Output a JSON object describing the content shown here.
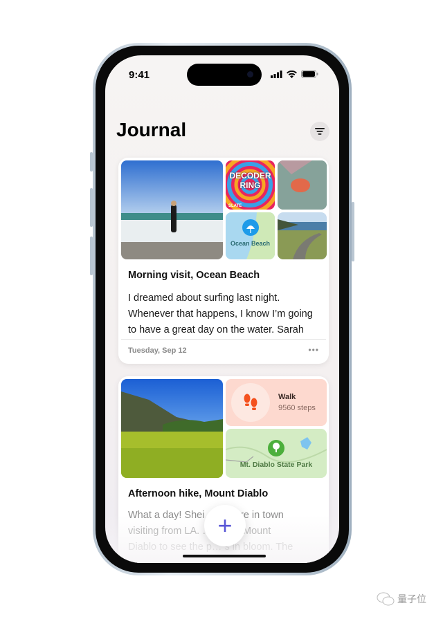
{
  "status_bar": {
    "time": "9:41"
  },
  "header": {
    "title": "Journal",
    "filter_icon": "filter-lines-icon"
  },
  "entries": [
    {
      "title": "Morning visit, Ocean Beach",
      "body": "I dreamed about surfing last night. Whenever that happens, I know I’m going to have a great day on the water. Sarah",
      "date": "Tuesday, Sep 12",
      "more_label": "•••",
      "media": {
        "podcast_art_title": "DECODER RING",
        "podcast_art_brand": "SLATE",
        "map_label": "Ocean Beach"
      }
    },
    {
      "title": "Afternoon hike, Mount Diablo",
      "body_visible_lines": [
        "What a day! Shei… aro are in town",
        "visiting from LA. … out to Mount",
        "Diablo to see the p… s in bloom. The"
      ],
      "activity": {
        "label": "Walk",
        "value": "9560 steps"
      },
      "map_label": "Mt. Diablo State Park"
    }
  ],
  "fab": {
    "label": "+"
  },
  "watermark": {
    "text": "量子位"
  },
  "colors": {
    "accent": "#5856d6",
    "walk_bg": "#fdd9cf",
    "walk_icon": "#f4511e",
    "map_pin_blue": "#1e9be9",
    "map_pin_green": "#4caf3c"
  }
}
